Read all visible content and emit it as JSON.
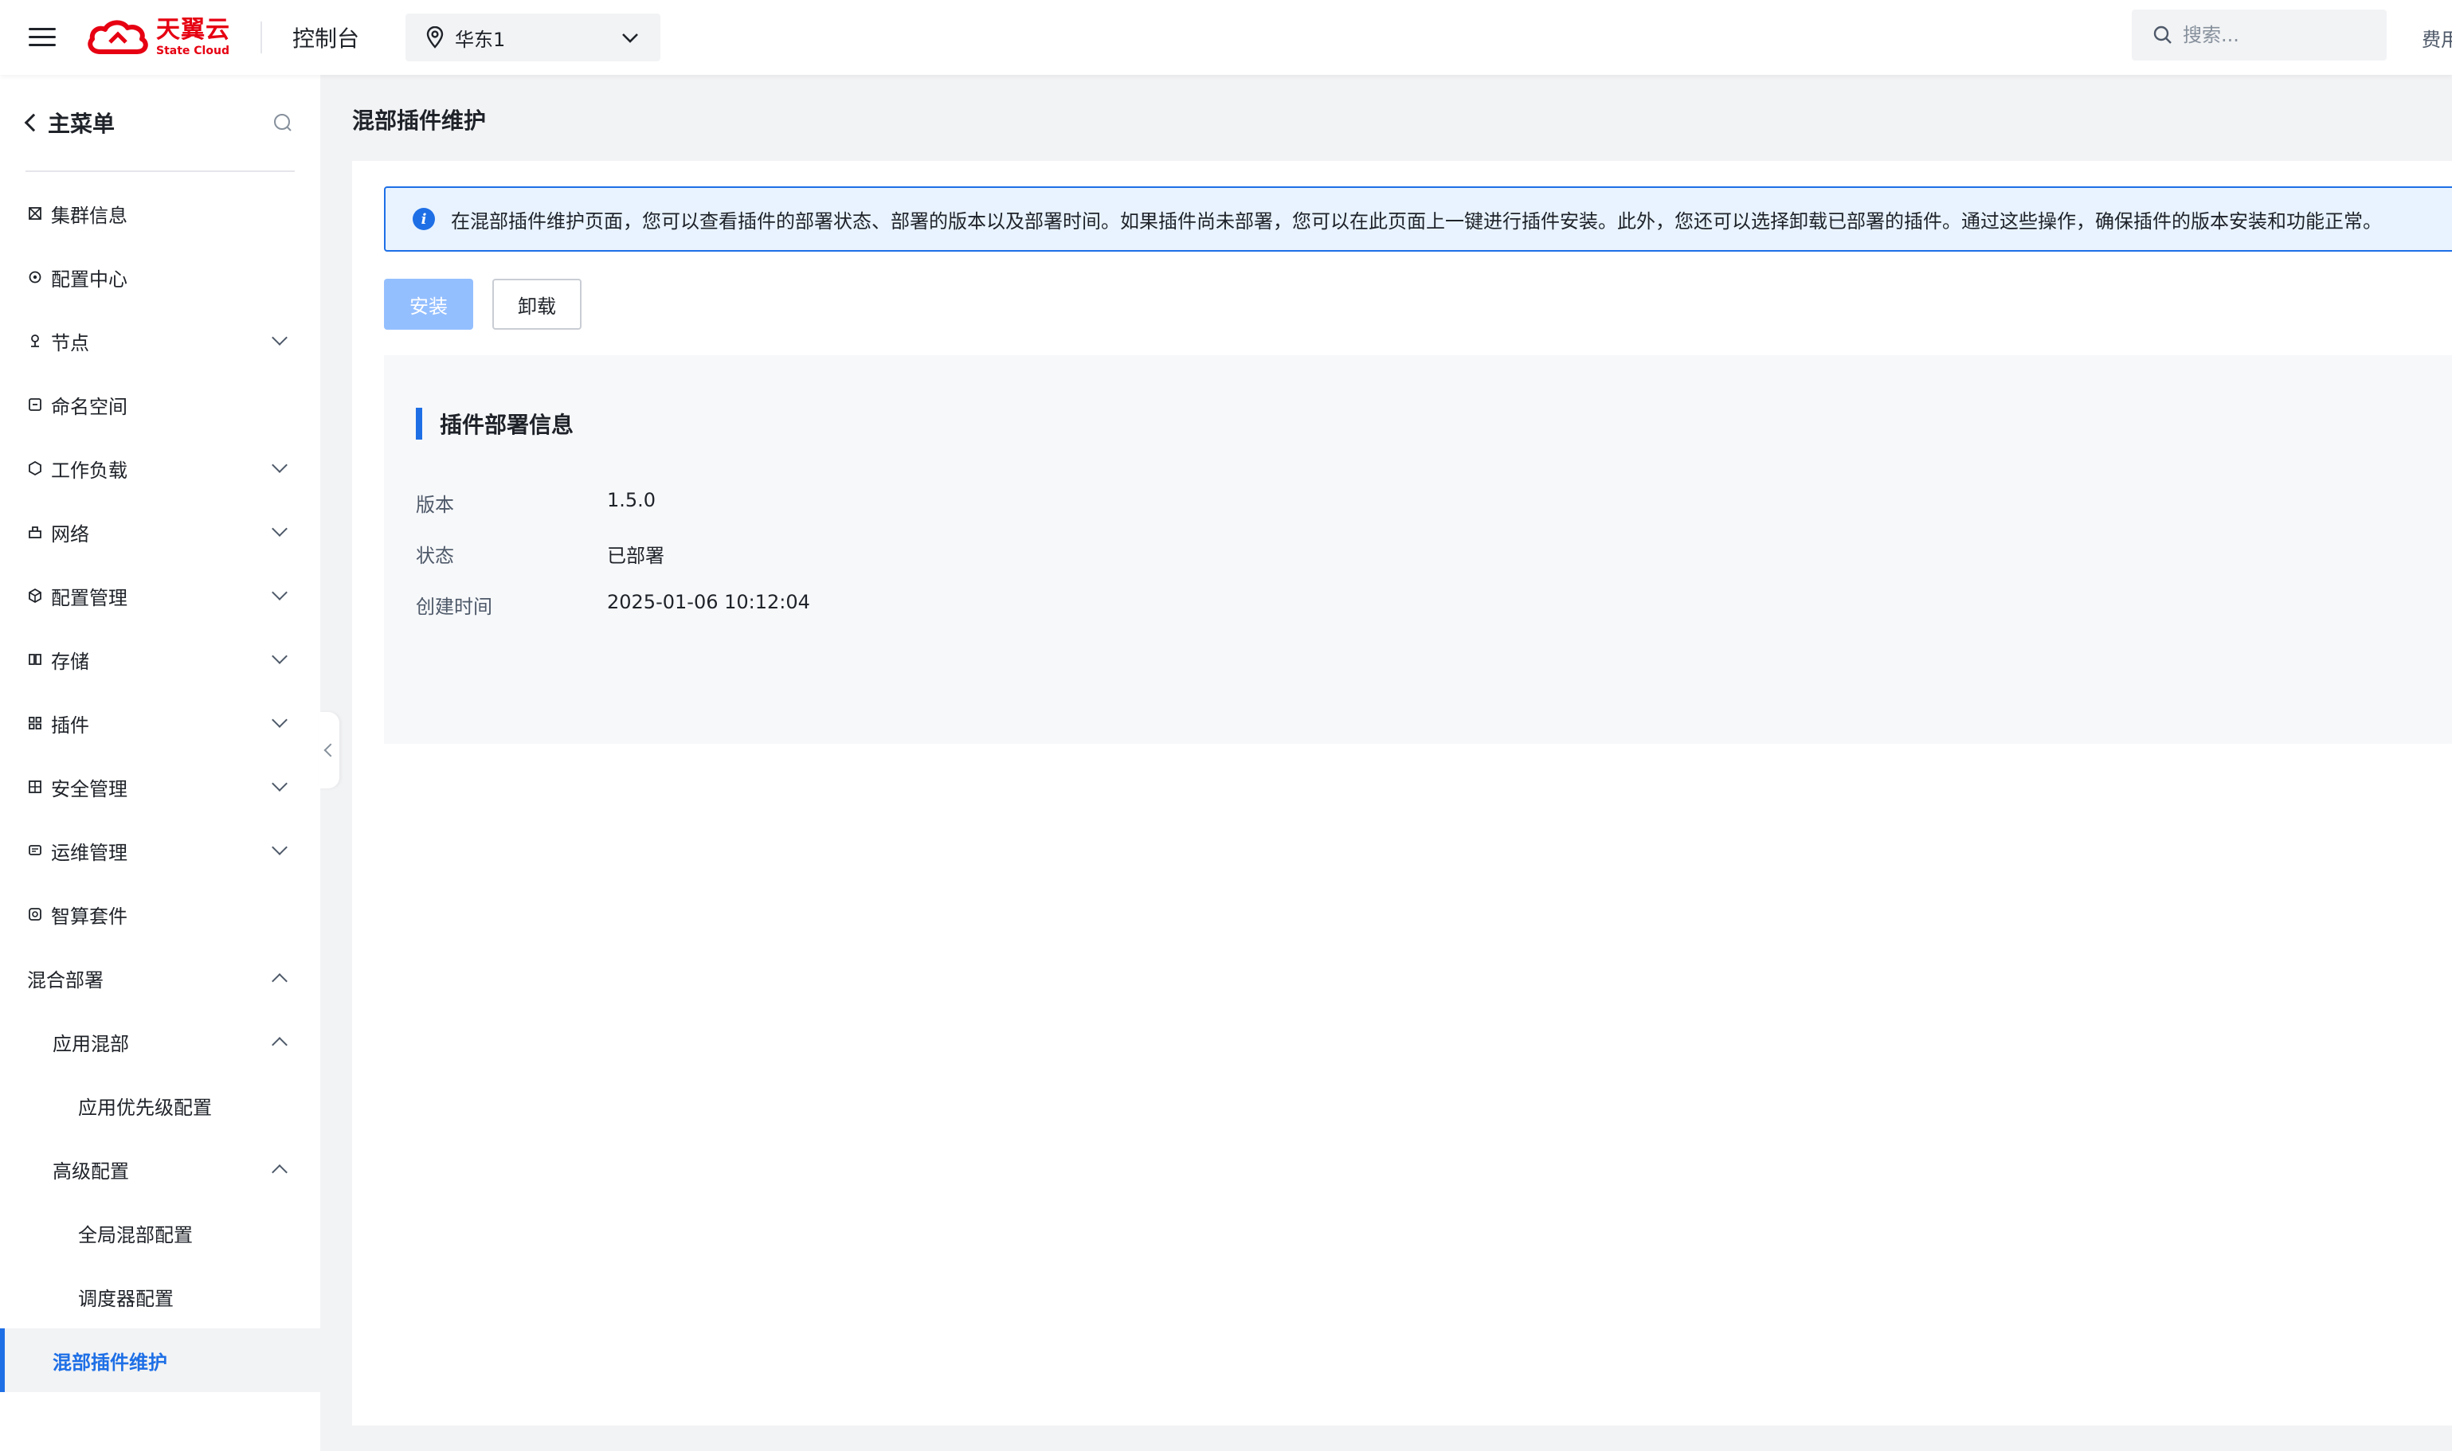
{
  "topbar": {
    "logo_cn": "天翼云",
    "logo_en": "State Cloud",
    "console_title": "控制台",
    "region": "华东1",
    "search_placeholder": "搜索...",
    "fee_link": "费用"
  },
  "sidebar": {
    "title": "主菜单",
    "items": [
      {
        "label": "集群信息",
        "icon": "cluster-icon"
      },
      {
        "label": "配置中心",
        "icon": "config-center-icon"
      },
      {
        "label": "节点",
        "icon": "node-icon",
        "expandable": true
      },
      {
        "label": "命名空间",
        "icon": "namespace-icon"
      },
      {
        "label": "工作负载",
        "icon": "workload-icon",
        "expandable": true
      },
      {
        "label": "网络",
        "icon": "network-icon",
        "expandable": true
      },
      {
        "label": "配置管理",
        "icon": "config-manage-icon",
        "expandable": true
      },
      {
        "label": "存储",
        "icon": "storage-icon",
        "expandable": true
      },
      {
        "label": "插件",
        "icon": "plugin-icon",
        "expandable": true
      },
      {
        "label": "安全管理",
        "icon": "security-icon",
        "expandable": true
      },
      {
        "label": "运维管理",
        "icon": "ops-icon",
        "expandable": true
      },
      {
        "label": "智算套件",
        "icon": "ai-suite-icon"
      }
    ],
    "hybrid": {
      "label": "混合部署",
      "app_hybrid": "应用混部",
      "app_priority": "应用优先级配置",
      "advanced": "高级配置",
      "global_config": "全局混部配置",
      "scheduler_config": "调度器配置",
      "plugin_maintenance": "混部插件维护"
    }
  },
  "page": {
    "title": "混部插件维护",
    "info": "在混部插件维护页面，您可以查看插件的部署状态、部署的版本以及部署时间。如果插件尚未部署，您可以在此页面上一键进行插件安装。此外，您还可以选择卸载已部署的插件。通过这些操作，确保插件的版本安装和功能正常。",
    "install_button": "安装",
    "uninstall_button": "卸载",
    "panel_title": "插件部署信息",
    "fields": {
      "version_label": "版本",
      "version_value": "1.5.0",
      "status_label": "状态",
      "status_value": "已部署",
      "created_label": "创建时间",
      "created_value": "2025-01-06 10:12:04"
    }
  },
  "colors": {
    "brand_red": "#e60012",
    "primary_blue": "#1e6fe6",
    "disabled_blue": "#94bfff"
  }
}
